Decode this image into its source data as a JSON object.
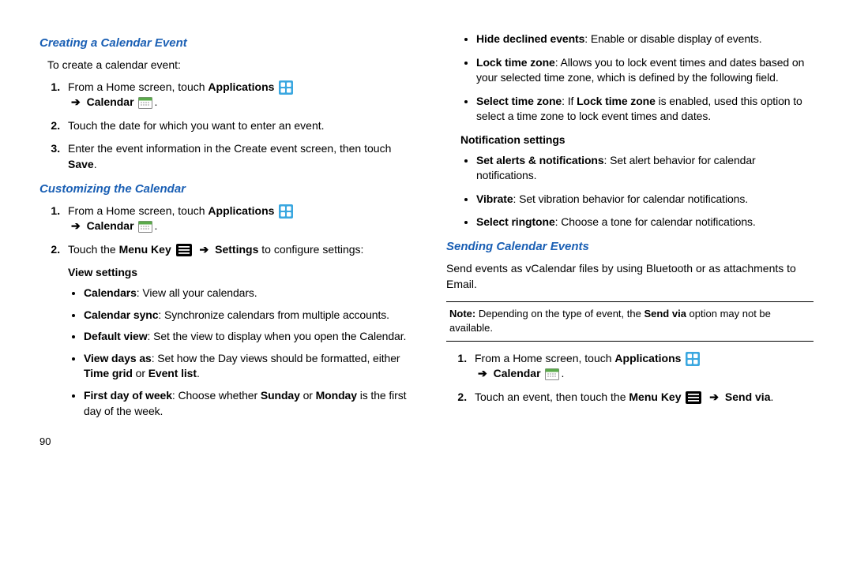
{
  "left": {
    "h1": "Creating a Calendar Event",
    "intro": "To create a calendar event:",
    "step1_a": "From a Home screen, touch ",
    "step1_b": "Applications",
    "step1_c": "Calendar",
    "step2": "Touch the date for which you want to enter an event.",
    "step3_a": "Enter the event information in the Create event screen, then touch ",
    "step3_b": "Save",
    "h2": "Customizing the Calendar",
    "cstep1_a": "From a Home screen, touch ",
    "cstep1_b": "Applications",
    "cstep1_c": "Calendar",
    "cstep2_a": "Touch the ",
    "cstep2_b": "Menu Key",
    "cstep2_c": "Settings",
    "cstep2_d": " to configure settings:",
    "view_settings": "View settings",
    "vs1_a": "Calendars",
    "vs1_b": ": View all your calendars.",
    "vs2_a": "Calendar sync",
    "vs2_b": ": Synchronize calendars from multiple accounts.",
    "vs3_a": "Default view",
    "vs3_b": ": Set the view to display when you open the Calendar.",
    "vs4_a": "View days as",
    "vs4_b": ": Set how the Day views should be formatted, either ",
    "vs4_c": "Time grid",
    "vs4_d": " or ",
    "vs4_e": "Event list",
    "vs5_a": "First day of week",
    "vs5_b": ": Choose whether ",
    "vs5_c": "Sunday",
    "vs5_d": " or ",
    "vs5_e": "Monday",
    "vs5_f": " is the first day of the week."
  },
  "right": {
    "r1_a": "Hide declined events",
    "r1_b": ": Enable or disable display of events.",
    "r2_a": "Lock time zone",
    "r2_b": ": Allows you to lock event times and dates based on your selected time zone, which is defined by the following field.",
    "r3_a": "Select time zone",
    "r3_b": ": If ",
    "r3_c": "Lock time zone",
    "r3_d": " is enabled, used this option to select a time zone to lock event times and dates.",
    "notif": "Notification settings",
    "n1_a": "Set alerts & notifications",
    "n1_b": ": Set alert behavior for calendar notifications.",
    "n2_a": "Vibrate",
    "n2_b": ": Set vibration behavior for calendar notifications.",
    "n3_a": "Select ringtone",
    "n3_b": ": Choose a tone for calendar notifications.",
    "h3": "Sending Calendar Events",
    "send_desc": "Send events as vCalendar files by using Bluetooth or as attachments to Email.",
    "note_a": "Note: ",
    "note_b": "Depending on the type of event, the ",
    "note_c": "Send via",
    "note_d": " option may not be available.",
    "s1_a": "From a Home screen, touch ",
    "s1_b": "Applications",
    "s1_c": "Calendar",
    "s2_a": "Touch an event, then touch the ",
    "s2_b": "Menu Key",
    "s2_c": "Send via"
  },
  "arrow": "➔",
  "page": "90"
}
